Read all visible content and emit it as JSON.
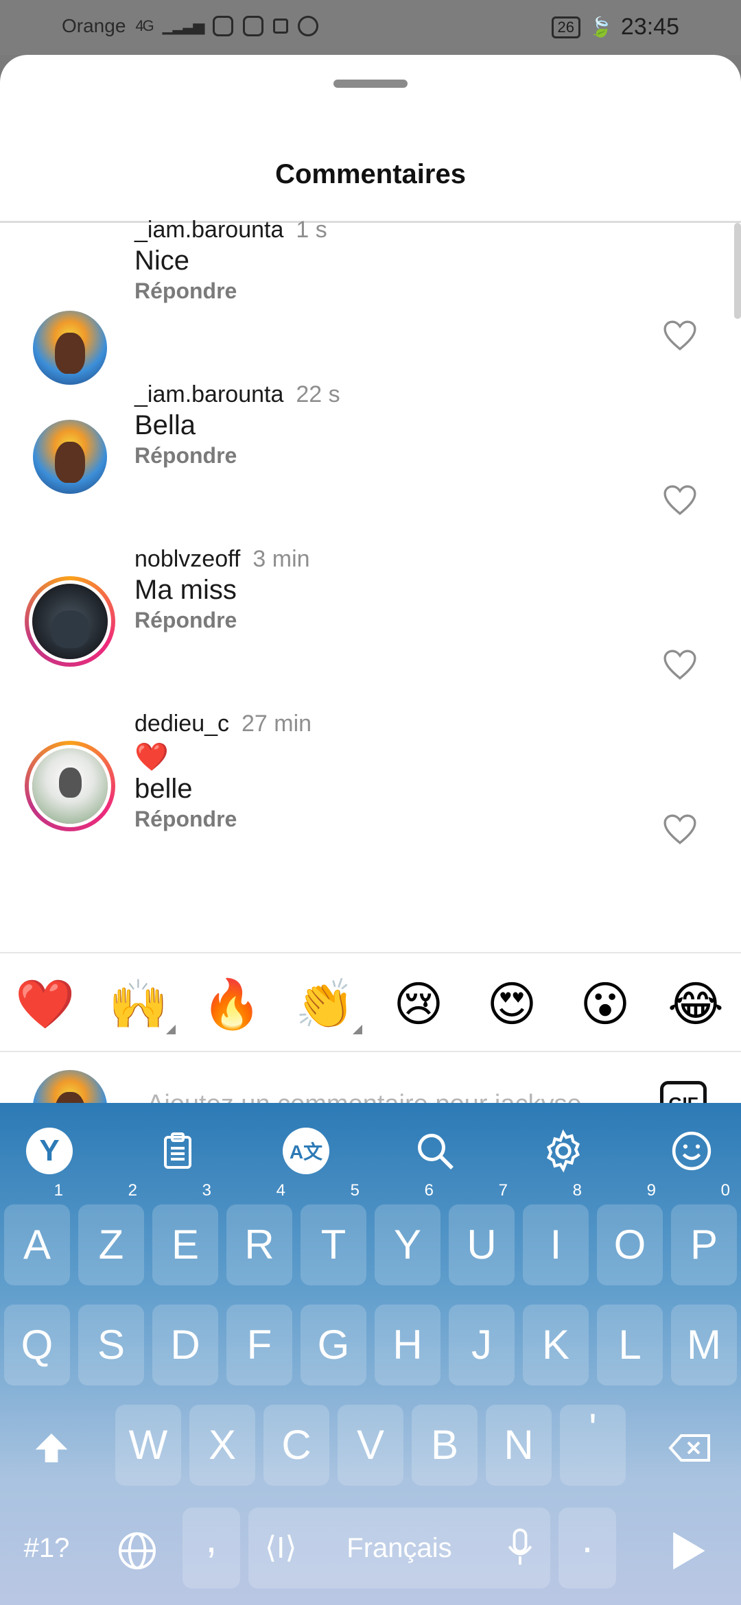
{
  "status_bar": {
    "carrier": "Orange",
    "network": "4G",
    "battery": "26",
    "time": "23:45"
  },
  "sheet": {
    "title": "Commentaires"
  },
  "comments": [
    {
      "username": "_iam.barounta",
      "time": "1 s",
      "text": "Nice",
      "reply_label": "Répondre",
      "avatar": "user-avatar"
    },
    {
      "username": "_iam.barounta",
      "time": "22 s",
      "text": "Bella",
      "reply_label": "Répondre",
      "avatar": "user-avatar"
    },
    {
      "username": "noblvzeoff",
      "time": "3 min",
      "text": "Ma miss",
      "reply_label": "Répondre",
      "avatar": "story-ring-avatar"
    },
    {
      "username": "dedieu_c",
      "time": "27 min",
      "emoji_line": "❤️",
      "text": "belle",
      "reply_label": "Répondre",
      "avatar": "story-ring-avatar"
    }
  ],
  "emoji_bar": [
    "❤️",
    "🙌",
    "🔥",
    "👏",
    "😢",
    "😍",
    "😮",
    "😂"
  ],
  "composer": {
    "placeholder": "Ajoutez un commentaire pour jackyse",
    "gif_label": "GIF"
  },
  "keyboard": {
    "row1": [
      {
        "key": "A",
        "num": "1"
      },
      {
        "key": "Z",
        "num": "2"
      },
      {
        "key": "E",
        "num": "3"
      },
      {
        "key": "R",
        "num": "4"
      },
      {
        "key": "T",
        "num": "5"
      },
      {
        "key": "Y",
        "num": "6"
      },
      {
        "key": "U",
        "num": "7"
      },
      {
        "key": "I",
        "num": "8"
      },
      {
        "key": "O",
        "num": "9"
      },
      {
        "key": "P",
        "num": "0"
      }
    ],
    "row2": [
      "Q",
      "S",
      "D",
      "F",
      "G",
      "H",
      "J",
      "K",
      "L",
      "M"
    ],
    "row3": [
      "W",
      "X",
      "C",
      "V",
      "B",
      "N",
      "'"
    ],
    "symbols_label": "#1?",
    "comma": ",",
    "space_label": "Français",
    "period": "."
  }
}
